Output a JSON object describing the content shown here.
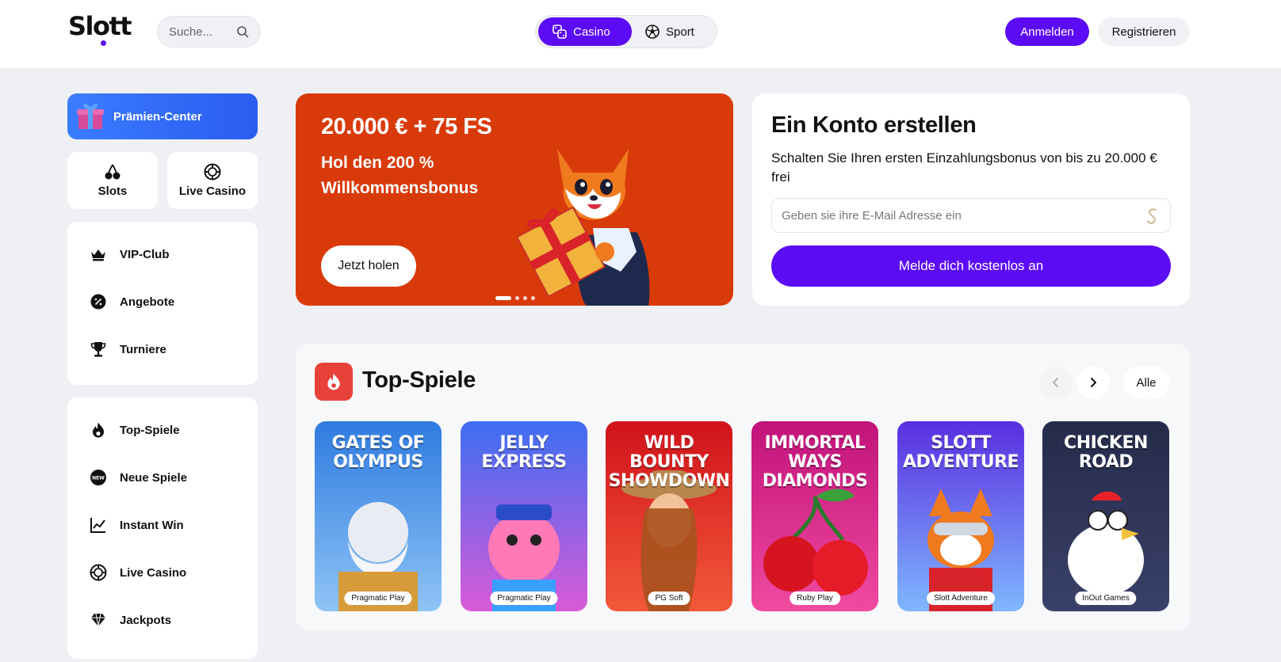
{
  "header": {
    "logo": "Slott",
    "search_placeholder": "Suche...",
    "toggle": {
      "casino": "Casino",
      "sport": "Sport"
    },
    "login": "Anmelden",
    "register": "Registrieren"
  },
  "sidebar": {
    "reward_center": "Prämien-Center",
    "tiles": [
      {
        "label": "Slots",
        "icon": "cherries-icon"
      },
      {
        "label": "Live Casino",
        "icon": "chip-icon"
      }
    ],
    "menu1": [
      {
        "label": "VIP-Club",
        "icon": "crown-icon"
      },
      {
        "label": "Angebote",
        "icon": "discount-badge-icon"
      },
      {
        "label": "Turniere",
        "icon": "trophy-icon"
      }
    ],
    "menu2": [
      {
        "label": "Top-Spiele",
        "icon": "flame-icon"
      },
      {
        "label": "Neue Spiele",
        "icon": "new-badge-icon"
      },
      {
        "label": "Instant Win",
        "icon": "chart-line-icon"
      },
      {
        "label": "Live Casino",
        "icon": "chip-icon"
      },
      {
        "label": "Jackpots",
        "icon": "diamond-icon"
      }
    ]
  },
  "promo": {
    "title": "20.000 € + 75 FS",
    "subtitle": "Hol den 200 % Willkommensbonus",
    "cta": "Jetzt holen",
    "slides": 4,
    "active_slide": 1
  },
  "signup": {
    "title": "Ein Konto erstellen",
    "text": "Schalten Sie Ihren ersten Einzahlungsbonus von bis zu 20.000 € frei",
    "email_placeholder": "Geben sie ihre E-Mail Adresse ein",
    "cta": "Melde dich kostenlos an"
  },
  "top_games": {
    "title": "Top-Spiele",
    "all": "Alle",
    "games": [
      {
        "name": "Gates of Olympus",
        "provider": "Pragmatic Play",
        "colors": [
          "#2f7be0",
          "#8fc4f5"
        ]
      },
      {
        "name": "Jelly Express",
        "provider": "Pragmatic Play",
        "colors": [
          "#3d6ef2",
          "#d95ad8"
        ]
      },
      {
        "name": "Wild Bounty Showdown",
        "provider": "PG Soft",
        "colors": [
          "#d0121a",
          "#f2593a"
        ]
      },
      {
        "name": "Immortal Ways Diamonds",
        "provider": "Ruby Play",
        "colors": [
          "#c1137a",
          "#f04aa0"
        ]
      },
      {
        "name": "Slott Adventure",
        "provider": "Slott Adventure",
        "colors": [
          "#5a2ee0",
          "#7fb7ff"
        ]
      },
      {
        "name": "Chicken Road",
        "provider": "InOut Games",
        "colors": [
          "#252b4a",
          "#3a4168"
        ]
      }
    ]
  },
  "colors": {
    "brand": "#5b0cf5",
    "promo_bg": "#d93a0a",
    "reward_gradient": "#3b7cff"
  }
}
